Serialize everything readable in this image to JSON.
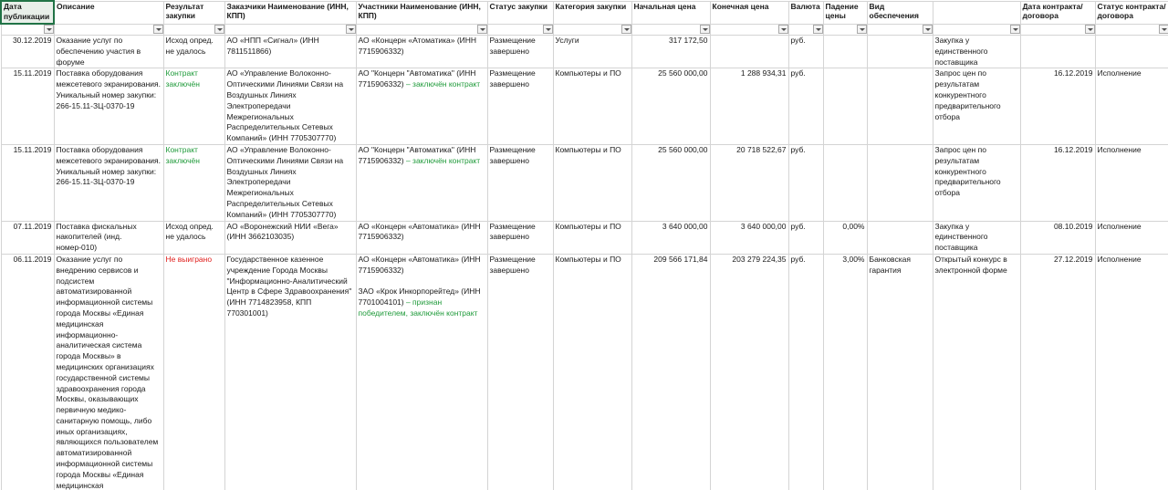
{
  "columns": [
    {
      "key": "date",
      "label": "Дата публикации"
    },
    {
      "key": "desc",
      "label": "Описание"
    },
    {
      "key": "result",
      "label": "Результат закупки"
    },
    {
      "key": "customers",
      "label": "Заказчики Наименование (ИНН, КПП)"
    },
    {
      "key": "participants",
      "label": "Участники Наименование (ИНН, КПП)"
    },
    {
      "key": "status",
      "label": "Статус закупки"
    },
    {
      "key": "category",
      "label": "Категория закупки"
    },
    {
      "key": "start_price",
      "label": "Начальная цена"
    },
    {
      "key": "final_price",
      "label": "Конечная цена"
    },
    {
      "key": "currency",
      "label": "Валюта"
    },
    {
      "key": "drop",
      "label": "Падение цены"
    },
    {
      "key": "security",
      "label": "Вид обеспечения"
    },
    {
      "key": "method",
      "label": ""
    },
    {
      "key": "contract_date",
      "label": "Дата контракта/договора"
    },
    {
      "key": "contract_status",
      "label": "Статус контракта/договора"
    }
  ],
  "rows": [
    {
      "date": "30.12.2019",
      "desc": "Оказание услуг по обеспечению участия в форуме",
      "result": "Исход опред. не удалось",
      "result_color": "",
      "customers": "АО «НПП «Сигнал» (ИНН 7811511866)",
      "participants": [
        {
          "text": "АО «Концерн «Атоматика» (ИНН 7715906332)",
          "note": ""
        }
      ],
      "status": "Размещение завершено",
      "category": "Услуги",
      "start_price": "317 172,50",
      "final_price": "",
      "currency": "руб.",
      "drop": "",
      "security": "",
      "method": "Закупка у единственного поставщика",
      "contract_date": "",
      "contract_status": ""
    },
    {
      "date": "15.11.2019",
      "desc": "Поставка оборудования межсетевого экранирования. Уникальный номер закупки: 266-15.11-ЗЦ-0370-19",
      "result": "Контракт заключён",
      "result_color": "green",
      "customers": "АО «Управление Волоконно-Оптическими Линиями Связи на Воздушных Линиях Электропередачи Межрегиональных Распределительных Сетевых Компаний» (ИНН 7705307770)",
      "participants": [
        {
          "text": "АО \"Концерн \"Автоматика\" (ИНН 7715906332)",
          "note": " – заключён контракт"
        }
      ],
      "status": "Размещение завершено",
      "category": "Компьютеры и ПО",
      "start_price": "25 560 000,00",
      "final_price": "1 288 934,31",
      "currency": "руб.",
      "drop": "",
      "security": "",
      "method": "Запрос цен по результатам конкурентного предварительного отбора",
      "contract_date": "16.12.2019",
      "contract_status": "Исполнение"
    },
    {
      "date": "15.11.2019",
      "desc": "Поставка оборудования межсетевого экранирования. Уникальный номер закупки: 266-15.11-ЗЦ-0370-19",
      "result": "Контракт заключён",
      "result_color": "green",
      "customers": "АО «Управление Волоконно-Оптическими Линиями Связи на Воздушных Линиях Электропередачи Межрегиональных Распределительных Сетевых Компаний» (ИНН 7705307770)",
      "participants": [
        {
          "text": "АО \"Концерн \"Автоматика\" (ИНН 7715906332)",
          "note": " – заключён контракт"
        }
      ],
      "status": "Размещение завершено",
      "category": "Компьютеры и ПО",
      "start_price": "25 560 000,00",
      "final_price": "20 718 522,67",
      "currency": "руб.",
      "drop": "",
      "security": "",
      "method": "Запрос цен по результатам конкурентного предварительного отбора",
      "contract_date": "16.12.2019",
      "contract_status": "Исполнение"
    },
    {
      "date": "07.11.2019",
      "desc": "Поставка фискальных накопителей (инд. номер-010)",
      "result": "Исход опред. не удалось",
      "result_color": "",
      "customers": "АО «Воронежский НИИ «Вега» (ИНН 3662103035)",
      "participants": [
        {
          "text": "АО «Концерн «Автоматика» (ИНН 7715906332)",
          "note": ""
        }
      ],
      "status": "Размещение завершено",
      "category": "Компьютеры и ПО",
      "start_price": "3 640 000,00",
      "final_price": "3 640 000,00",
      "currency": "руб.",
      "drop": "0,00%",
      "security": "",
      "method": "Закупка у единственного поставщика",
      "contract_date": "08.10.2019",
      "contract_status": "Исполнение"
    },
    {
      "date": "06.11.2019",
      "desc": "Оказание услуг по внедрению сервисов и подсистем автоматизированной информационной системы города Москвы «Единая медицинская информационно-аналитическая система города Москвы» в медицинских организациях государственной системы здравоохранения города Москвы, оказывающих первичную медико-санитарную помощь, либо иных организациях, являющихся пользователем автоматизированной информационной системы города Москвы «Единая медицинская",
      "result": "Не выиграно",
      "result_color": "red",
      "customers": "Государственное казенное учреждение Города Москвы \"Информационно-Аналитический Центр в Сфере Здравоохранения\" (ИНН 7714823958, КПП 770301001)",
      "participants": [
        {
          "text": "АО «Концерн «Автоматика» (ИНН 7715906332)",
          "note": ""
        },
        {
          "text": "ЗАО «Крок Инкорпорейтед» (ИНН 7701004101)",
          "note": " – признан победителем, заключён контракт"
        }
      ],
      "status": "Размещение завершено",
      "category": "Компьютеры и ПО",
      "start_price": "209 566 171,84",
      "final_price": "203 279 224,35",
      "currency": "руб.",
      "drop": "3,00%",
      "security": "Банковская гарантия",
      "method": "Открытый конкурс в электронной форме",
      "contract_date": "27.12.2019",
      "contract_status": "Исполнение"
    }
  ],
  "colors": {
    "accent": "#217346",
    "green_text": "#1f9a3a",
    "red_text": "#e0201e",
    "grid": "#d4d4d4"
  },
  "icons": {
    "filter": "dropdown-arrow-icon"
  }
}
